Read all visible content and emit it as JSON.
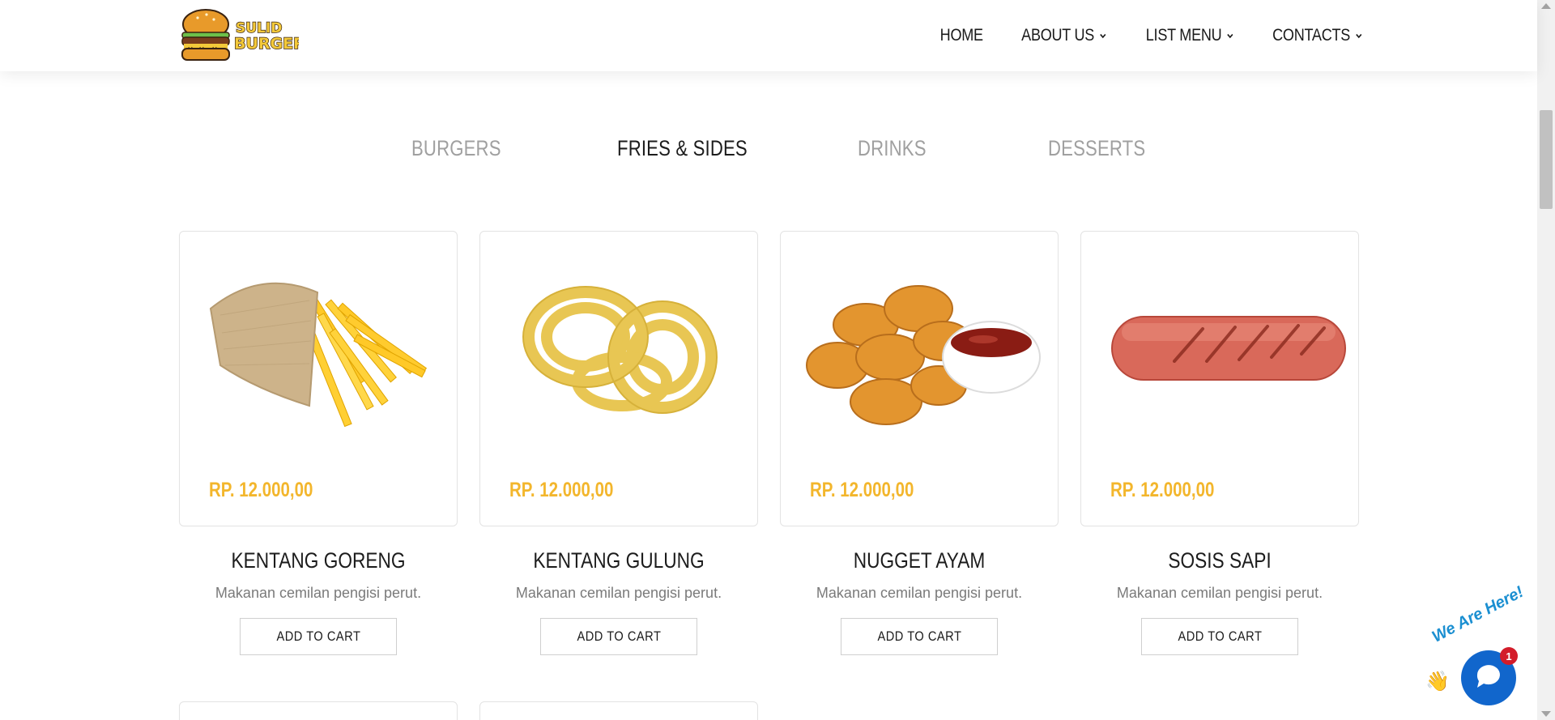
{
  "brand": {
    "logo_line1": "SULID",
    "logo_line2": "BURGER",
    "accent": "#f3b62c"
  },
  "nav": {
    "items": [
      {
        "label": "HOME",
        "dropdown": false
      },
      {
        "label": "ABOUT US",
        "dropdown": true
      },
      {
        "label": "LIST MENU",
        "dropdown": true
      },
      {
        "label": "CONTACTS",
        "dropdown": true
      }
    ]
  },
  "tabs": {
    "items": [
      {
        "label": "BURGERS",
        "active": false
      },
      {
        "label": "FRIES & SIDES",
        "active": true
      },
      {
        "label": "DRINKS",
        "active": false
      },
      {
        "label": "DESSERTS",
        "active": false
      }
    ]
  },
  "products": [
    {
      "name": "KENTANG GORENG",
      "price": "RP. 12.000,00",
      "description": "Makanan cemilan pengisi perut.",
      "button": "ADD TO CART",
      "image": "fries"
    },
    {
      "name": "KENTANG GULUNG",
      "price": "RP. 12.000,00",
      "description": "Makanan cemilan pengisi perut.",
      "button": "ADD TO CART",
      "image": "rolled-potato"
    },
    {
      "name": "NUGGET AYAM",
      "price": "RP. 12.000,00",
      "description": "Makanan cemilan pengisi perut.",
      "button": "ADD TO CART",
      "image": "chicken-nuggets"
    },
    {
      "name": "SOSIS SAPI",
      "price": "RP. 12.000,00",
      "description": "Makanan cemilan pengisi perut.",
      "button": "ADD TO CART",
      "image": "beef-sausage"
    }
  ],
  "chat": {
    "label": "We Are Here!",
    "badge": "1"
  }
}
